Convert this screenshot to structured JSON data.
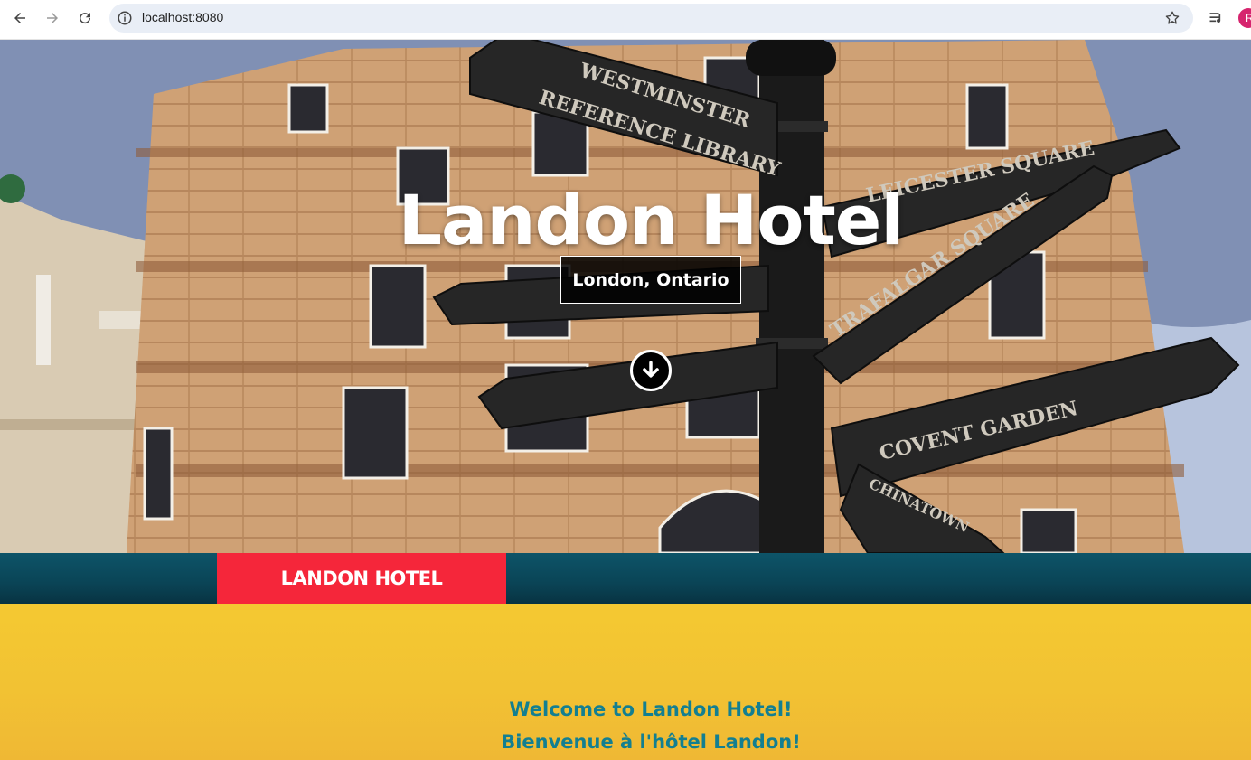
{
  "browser": {
    "url": "localhost:8080",
    "profile_initial": "R",
    "icons": [
      "back-arrow-icon",
      "forward-arrow-icon",
      "reload-icon",
      "info-icon",
      "star-icon",
      "reading-list-icon"
    ]
  },
  "hero": {
    "title": "Landon Hotel",
    "subtitle": "London, Ontario",
    "scroll_icon": "arrow-down-circle-icon",
    "signs": [
      "WESTMINSTER",
      "REFERENCE LIBRARY",
      "LEICESTER SQUARE",
      "TRAFALGAR SQUARE",
      "COVENT GARDEN",
      "CHINATOWN"
    ]
  },
  "nav": {
    "brand": "LANDON HOTEL"
  },
  "welcome": {
    "line_en": "Welcome to Landon Hotel!",
    "line_fr": "Bienvenue à l'hôtel Landon!"
  },
  "colors": {
    "brand_red": "#f5263a",
    "nav_teal": "#0a4456",
    "welcome_yellow": "#f3c533",
    "welcome_text": "#137f91"
  }
}
